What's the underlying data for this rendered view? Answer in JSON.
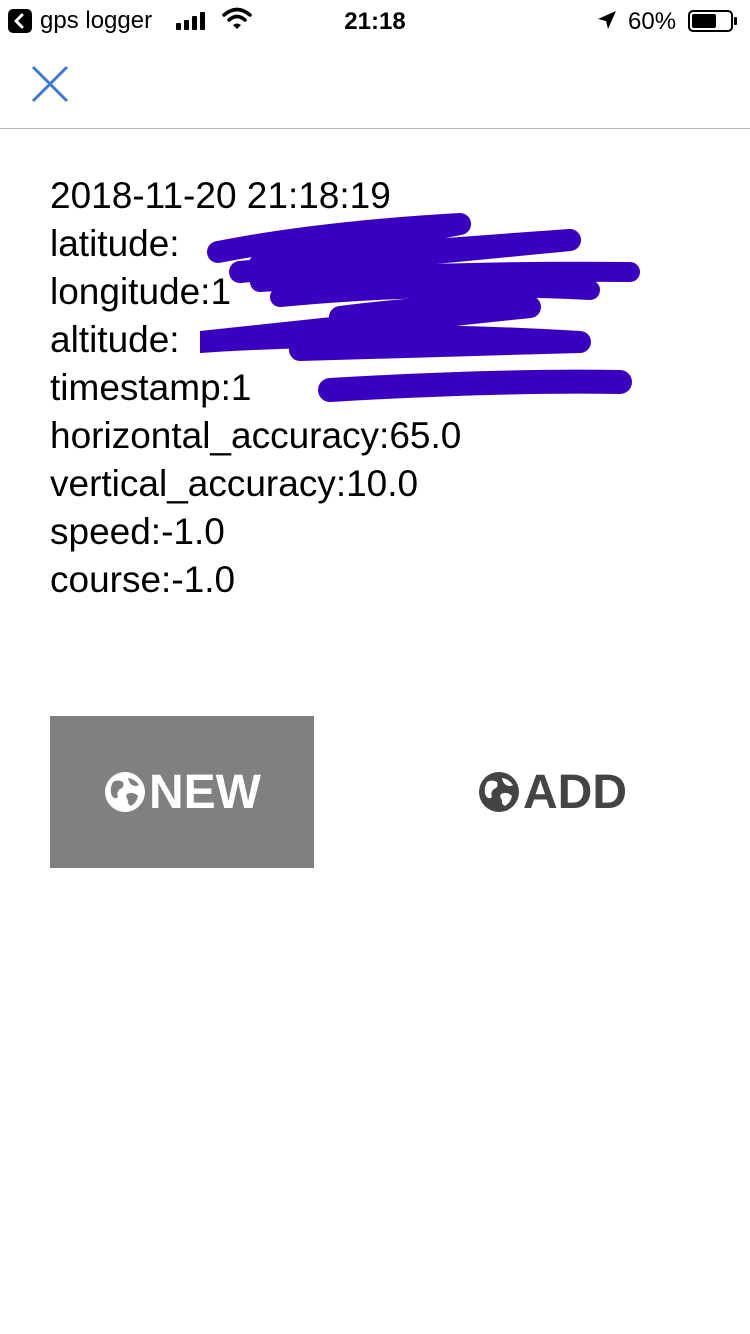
{
  "status_bar": {
    "back_app": "gps logger",
    "time": "21:18",
    "battery": "60%"
  },
  "nav": {
    "close_icon": "close-x-icon",
    "accent": "#3b7ad9"
  },
  "info": {
    "datetime": "2018-11-20 21:18:19",
    "latitude": "latitude:",
    "longitude": "longitude:1",
    "altitude": "altitude:",
    "timestamp": "timestamp:1",
    "horizontal_accuracy": "horizontal_accuracy:65.0",
    "vertical_accuracy": "vertical_accuracy:10.0",
    "speed": "speed:-1.0",
    "course": "course:-1.0"
  },
  "buttons": {
    "new_label": "NEW",
    "add_label": "ADD",
    "icon": "globe-icon",
    "new_bg": "#808080",
    "redaction_color": "#3a00c0"
  }
}
